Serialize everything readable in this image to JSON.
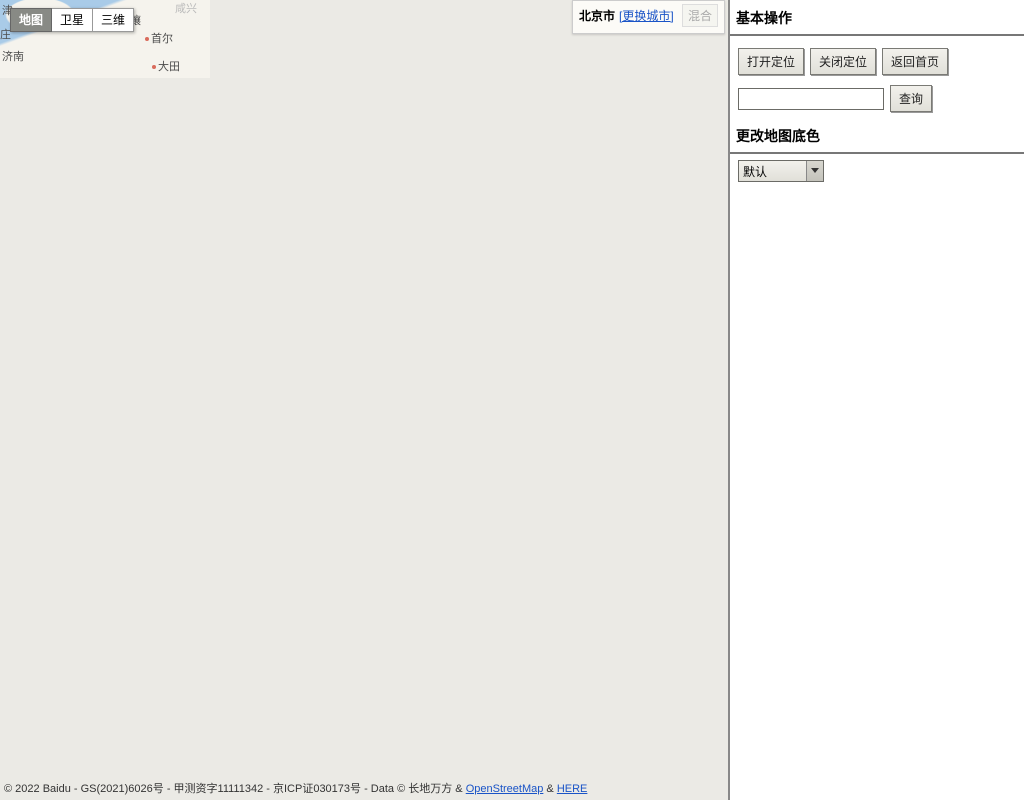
{
  "map": {
    "type_tabs": {
      "map": "地图",
      "satellite": "卫星",
      "three_d": "三维"
    },
    "cities": {
      "c1": "津",
      "c2": "首尔",
      "c3": "平壤",
      "c4": "济南",
      "c5": "大田",
      "c6": "庄",
      "c7": "咸兴"
    }
  },
  "city_panel": {
    "current_city": "北京市",
    "change_label": "[更换城市]",
    "hybrid_label": "混合"
  },
  "sidebar": {
    "section_basic": "基本操作",
    "btn_open_locate": "打开定位",
    "btn_close_locate": "关闭定位",
    "btn_home": "返回首页",
    "search_value": "",
    "btn_search": "查询",
    "section_bgcolor": "更改地图底色",
    "select_bgcolor_value": "默认"
  },
  "footer": {
    "p1": "© 2022 Baidu - GS(2021)6026号 - 甲测资字11111342 - 京ICP证030173号 - Data © 长地万方 & ",
    "osm": "OpenStreetMap",
    "amp": " & ",
    "here": "HERE "
  }
}
